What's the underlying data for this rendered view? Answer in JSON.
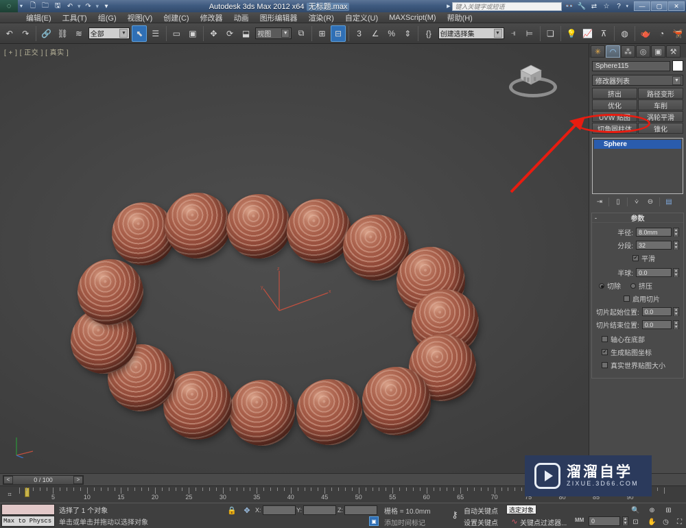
{
  "window": {
    "title_prefix": "Autodesk 3ds Max  2012 x64",
    "title_file": "无标题.max",
    "app_logo": "3ds-max-logo",
    "minimize": "—",
    "maximize": "▢",
    "close": "✕"
  },
  "quick_access": {
    "items": [
      {
        "name": "new-file",
        "glyph": "🗋"
      },
      {
        "name": "open-file",
        "glyph": "🗀"
      },
      {
        "name": "save-file",
        "glyph": "🖫"
      },
      {
        "name": "undo",
        "glyph": "↶"
      },
      {
        "name": "redo",
        "glyph": "↷"
      },
      {
        "name": "customize-qat",
        "glyph": "▾"
      }
    ]
  },
  "search": {
    "placeholder": "键入关键字或短语",
    "icons": [
      {
        "name": "search-binoculars-icon",
        "glyph": "👓"
      },
      {
        "name": "wrench-icon",
        "glyph": "🔧"
      },
      {
        "name": "exchange-icon",
        "glyph": "⇄"
      },
      {
        "name": "favorite-star-icon",
        "glyph": "☆"
      },
      {
        "name": "help-circle-icon",
        "glyph": "?"
      }
    ]
  },
  "menu": {
    "items": [
      "编辑(E)",
      "工具(T)",
      "组(G)",
      "视图(V)",
      "创建(C)",
      "修改器",
      "动画",
      "图形编辑器",
      "渲染(R)",
      "自定义(U)",
      "MAXScript(M)",
      "帮助(H)"
    ]
  },
  "toolbar": {
    "select_filter": "全部",
    "ref_coord_system": "视图",
    "named_selection_set": "创建选择集",
    "groups": [
      {
        "name": "undo-button",
        "glyph": "↶"
      },
      {
        "name": "redo-button",
        "glyph": "↷"
      },
      {
        "name": "select-link-button",
        "glyph": "🔗"
      },
      {
        "name": "unlink-button",
        "glyph": "⛓"
      },
      {
        "name": "bind-space-warp-button",
        "glyph": "≋"
      },
      {
        "name": "select-object-button",
        "glyph": "⬉"
      },
      {
        "name": "select-by-name-button",
        "glyph": "☰"
      },
      {
        "name": "rect-selection-region-button",
        "glyph": "▭"
      },
      {
        "name": "window-crossing-button",
        "glyph": "▣"
      },
      {
        "name": "select-move-button",
        "glyph": "✥"
      },
      {
        "name": "select-rotate-button",
        "glyph": "⟳"
      },
      {
        "name": "select-scale-button",
        "glyph": "⬓"
      },
      {
        "name": "mirror-button",
        "glyph": "⊞"
      },
      {
        "name": "align-button",
        "glyph": "⊟"
      },
      {
        "name": "snap-toggle-button",
        "glyph": "3"
      },
      {
        "name": "angle-snap-button",
        "glyph": "∠"
      },
      {
        "name": "percent-snap-button",
        "glyph": "%"
      },
      {
        "name": "spinner-snap-button",
        "glyph": "⇕"
      },
      {
        "name": "edit-named-selection-button",
        "glyph": "{}"
      },
      {
        "name": "mirror-tool-button",
        "glyph": "⫣"
      },
      {
        "name": "align-tool-button",
        "glyph": "⊨"
      },
      {
        "name": "layer-manager-button",
        "glyph": "❏"
      },
      {
        "name": "light-lister-button",
        "glyph": "💡"
      },
      {
        "name": "curve-editor-button",
        "glyph": "📈"
      },
      {
        "name": "schematic-view-button",
        "glyph": "⊼"
      },
      {
        "name": "material-editor-button",
        "glyph": "◍"
      },
      {
        "name": "render-setup-button",
        "glyph": "🫖"
      },
      {
        "name": "rendered-frame-button",
        "glyph": "◔"
      },
      {
        "name": "render-production-button",
        "glyph": "🫕"
      }
    ]
  },
  "viewport": {
    "label": "[ + ] [ 正交 ] [ 真实 ]",
    "viewcube_name": "view-cube",
    "axis_labels": {
      "x": "x",
      "y": "y",
      "z": "z"
    },
    "scene_description": "wooden-bead-bracelet",
    "bead_color_light": "#c98a72",
    "bead_color_mid": "#a9604b",
    "bead_color_dark": "#5e2a20",
    "background_color": "#454545"
  },
  "command_panel": {
    "tabs": [
      {
        "name": "create-tab",
        "glyph": "✳",
        "active": false
      },
      {
        "name": "modify-tab",
        "glyph": "◟",
        "active": true
      },
      {
        "name": "hierarchy-tab",
        "glyph": "⁂",
        "active": false
      },
      {
        "name": "motion-tab",
        "glyph": "◎",
        "active": false
      },
      {
        "name": "display-tab",
        "glyph": "▣",
        "active": false
      },
      {
        "name": "utilities-tab",
        "glyph": "🔨",
        "active": false
      }
    ],
    "object_name": "Sphere115",
    "object_color": "#ffffff",
    "modifier_list_label": "修改器列表",
    "modifier_buttons": [
      "挤出",
      "路径变形",
      "优化",
      "车削",
      "UVW 贴图",
      "涡轮平滑",
      "切角圆柱体",
      "锥化"
    ],
    "stack": [
      {
        "label": "Sphere",
        "selected": true
      }
    ],
    "stack_tools": [
      {
        "name": "pin-stack-icon",
        "glyph": "⇥"
      },
      {
        "name": "show-end-result-icon",
        "glyph": "▯"
      },
      {
        "name": "make-unique-icon",
        "glyph": "⩒"
      },
      {
        "name": "remove-modifier-icon",
        "glyph": "⊖"
      },
      {
        "name": "configure-modifier-sets-icon",
        "glyph": "▤"
      }
    ],
    "parameters": {
      "title": "参数",
      "radius_label": "半径:",
      "radius_value": "8.0mm",
      "segments_label": "分段:",
      "segments_value": "32",
      "smooth_label": "平滑",
      "smooth_checked": true,
      "hemisphere_label": "半球:",
      "hemisphere_value": "0.0",
      "chop_label": "切除",
      "chop_selected": true,
      "squash_label": "挤压",
      "squash_selected": false,
      "slice_on_label": "启用切片",
      "slice_on_checked": false,
      "slice_from_label": "切片起始位置:",
      "slice_from_value": "0.0",
      "slice_to_label": "切片结束位置:",
      "slice_to_value": "0.0",
      "base_to_pivot_label": "轴心在底部",
      "base_to_pivot_checked": false,
      "gen_map_coords_label": "生成贴图坐标",
      "gen_map_coords_checked": true,
      "real_world_label": "真实世界贴图大小",
      "real_world_checked": false
    }
  },
  "annotation": {
    "highlight_target": "UVW 贴图",
    "color": "#e81c10",
    "shape": "ellipse-with-arrow"
  },
  "time_slider": {
    "current": "0 / 100",
    "prev_glyph": "<",
    "next_glyph": ">"
  },
  "track_bar": {
    "tick_labels": [
      "5",
      "10",
      "15",
      "20",
      "25",
      "30",
      "35",
      "40",
      "45",
      "50",
      "55",
      "60",
      "65",
      "70",
      "75",
      "80",
      "85",
      "90"
    ],
    "key_icon": "key-mode-icon"
  },
  "status_bar": {
    "maxscript_listener_text": "Max to Physcs C",
    "selection_status": "选择了 1 个对象",
    "prompt": "单击或单击并拖动以选择对象",
    "lock_icon": "lock-selection-icon",
    "xform_icon": "absolute-relative-transform-icon",
    "x_label": "X:",
    "x_value": "",
    "y_label": "Y:",
    "y_value": "",
    "z_label": "Z:",
    "z_value": "",
    "grid_text": "栅格 = 10.0mm",
    "add_time_tag": "添加时间标记",
    "key_mode_icon": "key-toggle-icon",
    "auto_key": "自动关键点",
    "selected_object": "选定对象",
    "set_key": "设置关键点",
    "key_filters": "关键点过滤器...",
    "mm_label": "MM",
    "frame_value": "0",
    "nav_icons": [
      {
        "name": "zoom-icon",
        "glyph": "🔍"
      },
      {
        "name": "zoom-all-icon",
        "glyph": "⊕"
      },
      {
        "name": "zoom-extents-icon",
        "glyph": "⊞"
      },
      {
        "name": "zoom-region-icon",
        "glyph": "⊡"
      },
      {
        "name": "pan-view-icon",
        "glyph": "✋"
      },
      {
        "name": "orbit-icon",
        "glyph": "◷"
      },
      {
        "name": "maximize-viewport-icon",
        "glyph": "⛶"
      }
    ]
  },
  "watermark": {
    "brand": "溜溜自学",
    "url": "ZIXUE.3D66.COM",
    "logo_name": "play-button-logo",
    "bg_color": "#2b3a5c"
  }
}
